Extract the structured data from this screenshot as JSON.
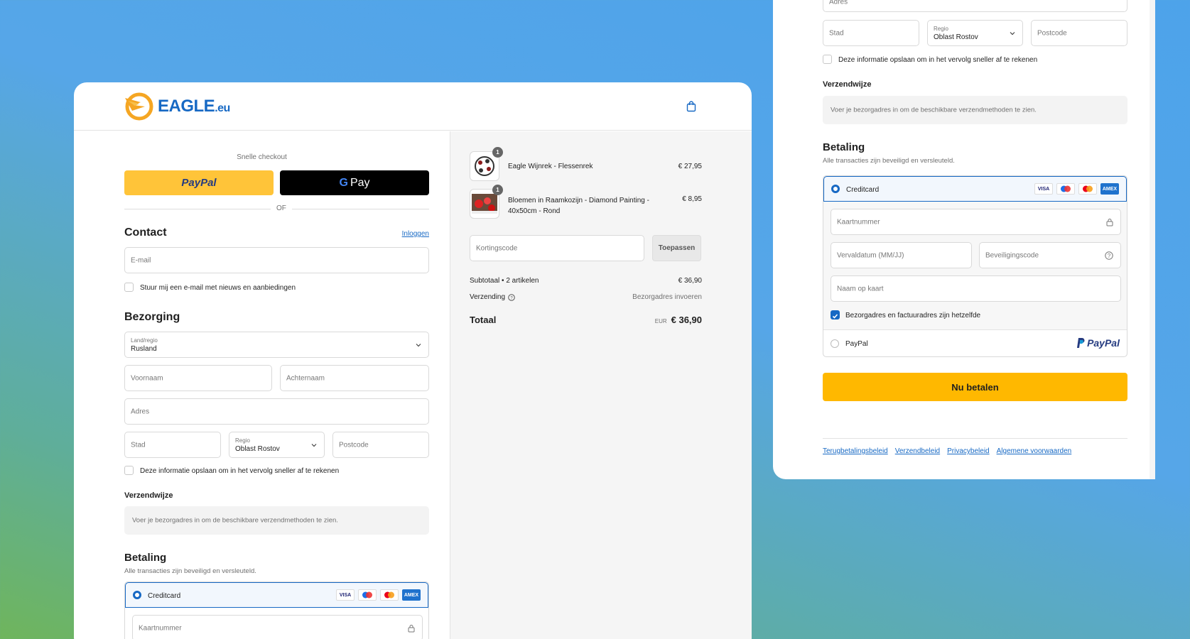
{
  "brand": {
    "name": "EAGLE",
    "tld": ".eu"
  },
  "express": {
    "label": "Snelle checkout",
    "paypal": "PayPal",
    "gpay": "Pay",
    "or": "OF"
  },
  "contact": {
    "title": "Contact",
    "login": "Inloggen",
    "email_placeholder": "E-mail",
    "newsletter": "Stuur mij een e-mail met nieuws en aanbiedingen"
  },
  "delivery": {
    "title": "Bezorging",
    "country_label": "Land/regio",
    "country_value": "Rusland",
    "first_name": "Voornaam",
    "last_name": "Achternaam",
    "address": "Adres",
    "city": "Stad",
    "region_label": "Regio",
    "region_value": "Oblast Rostov",
    "postcode": "Postcode",
    "save_info": "Deze informatie opslaan om in het vervolg sneller af te rekenen"
  },
  "shipping": {
    "title": "Verzendwijze",
    "note": "Voer je bezorgadres in om de beschikbare verzendmethoden te zien."
  },
  "payment": {
    "title": "Betaling",
    "subtitle": "Alle transacties zijn beveiligd en versleuteld.",
    "creditcard": "Creditcard",
    "card_number": "Kaartnummer",
    "expiry": "Vervaldatum (MM/JJ)",
    "cvc": "Beveiligingscode",
    "name_on_card": "Naam op kaart",
    "same_address": "Bezorgadres en factuuradres zijn hetzelfde",
    "paypal": "PayPal",
    "pay_now": "Nu betalen",
    "card_brands": [
      "VISA",
      "",
      "",
      "AMEX"
    ]
  },
  "cart": {
    "items": [
      {
        "name": "Eagle Wijnrek - Flessenrek",
        "price": "€ 27,95",
        "qty": "1"
      },
      {
        "name": "Bloemen in Raamkozijn - Diamond Painting - 40x50cm - Rond",
        "price": "€ 8,95",
        "qty": "1"
      }
    ],
    "discount_placeholder": "Kortingscode",
    "apply": "Toepassen",
    "subtotal_label": "Subtotaal • 2 artikelen",
    "subtotal": "€ 36,90",
    "shipping_label": "Verzending",
    "shipping_value": "Bezorgadres invoeren",
    "total_label": "Totaal",
    "currency": "EUR",
    "total": "€ 36,90"
  },
  "footer": {
    "links": [
      "Terugbetalingsbeleid",
      "Verzendbeleid",
      "Privacybeleid",
      "Algemene voorwaarden"
    ]
  },
  "colors": {
    "accent": "#1769c4",
    "paypal_yellow": "#ffc439",
    "pay_button": "#ffb800"
  }
}
